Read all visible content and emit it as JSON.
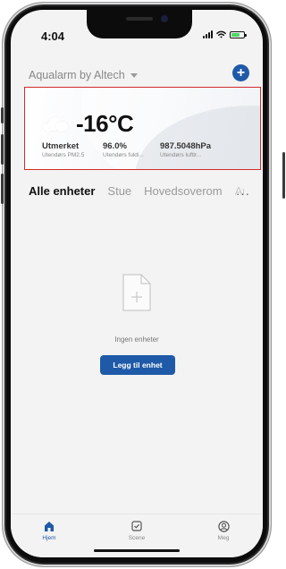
{
  "status_bar": {
    "time": "4:04",
    "battery_level": 0.7
  },
  "header": {
    "home_name": "Aqualarm by Altech"
  },
  "weather": {
    "temperature": "-16°C",
    "condition_icon": "cloud-icon",
    "metrics": [
      {
        "value": "Utmerket",
        "label": "Utendørs PM2.5"
      },
      {
        "value": "96.0%",
        "label": "Utendørs fukti..."
      },
      {
        "value": "987.5048hPa",
        "label": "Utendørs lufttr..."
      }
    ]
  },
  "tabs": [
    {
      "label": "Alle enheter",
      "active": true
    },
    {
      "label": "Stue"
    },
    {
      "label": "Hovedsoverom"
    },
    {
      "label": "Ar"
    }
  ],
  "more_label": "···",
  "empty_state": {
    "icon": "add-file-icon",
    "message": "Ingen enheter",
    "button_label": "Legg til enhet"
  },
  "bottom_nav": [
    {
      "label": "Hjem",
      "icon": "home-icon",
      "active": true
    },
    {
      "label": "Scene",
      "icon": "scene-checkbox-icon"
    },
    {
      "label": "Meg",
      "icon": "profile-icon"
    }
  ],
  "colors": {
    "accent": "#1e5aa7",
    "highlight_border": "#d42b2b"
  }
}
